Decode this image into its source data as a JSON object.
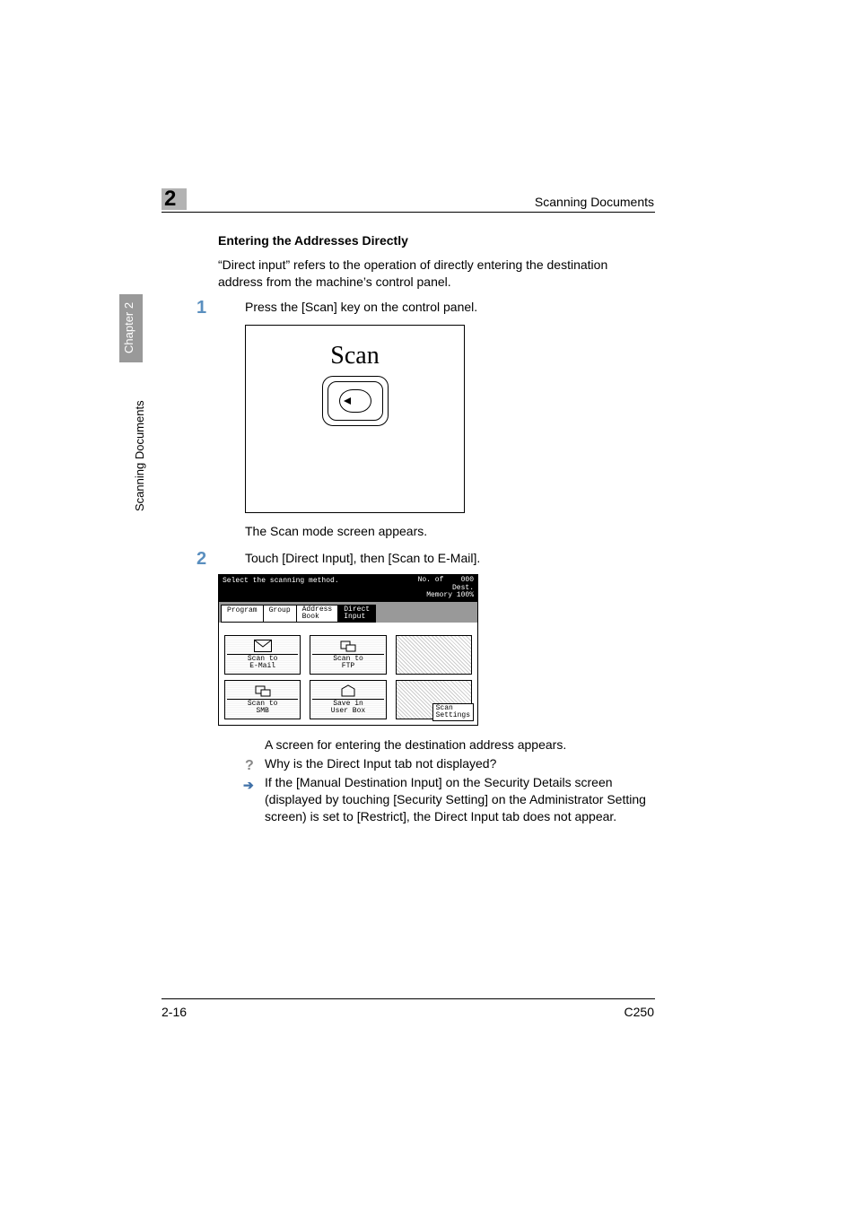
{
  "header": {
    "section_title": "Scanning Documents",
    "chapter_number": "2"
  },
  "side": {
    "tab_label": "Chapter 2",
    "section_label": "Scanning Documents"
  },
  "content": {
    "subheading": "Entering the Addresses Directly",
    "intro": "“Direct input” refers to the operation of directly entering the destination address from the machine’s control panel.",
    "step1_num": "1",
    "step1_text": "Press the [Scan] key on the control panel.",
    "fig1_label": "Scan",
    "after_fig1": "The Scan mode screen appears.",
    "step2_num": "2",
    "step2_text": "Touch [Direct Input], then [Scan to E-Mail].",
    "panel": {
      "prompt": "Select the scanning method.",
      "dest_line1": "No. of",
      "dest_line2": "Dest.",
      "dest_count": "000",
      "memory": "Memory 100%",
      "tabs": {
        "program": "Program",
        "group": "Group",
        "address_book": "Address\nBook",
        "direct_input": "Direct\nInput"
      },
      "cards": {
        "scan_email": "Scan to\nE-Mail",
        "scan_ftp_top": "FTP",
        "scan_ftp": "Scan to\nFTP",
        "scan_smb_top": "SMB",
        "scan_smb": "Scan to\nSMB",
        "save_box": "Save in\nUser Box"
      },
      "scan_settings": "Scan\nSettings"
    },
    "after_fig2": "A screen for entering the destination address appears.",
    "q_line": "Why is the Direct Input tab not displayed?",
    "a_line": "If the [Manual Destination Input] on the Security Details screen (displayed by touching [Security Setting] on the Administrator Setting screen) is set to [Restrict], the Direct Input tab does not appear."
  },
  "footer": {
    "page": "2-16",
    "model": "C250"
  }
}
